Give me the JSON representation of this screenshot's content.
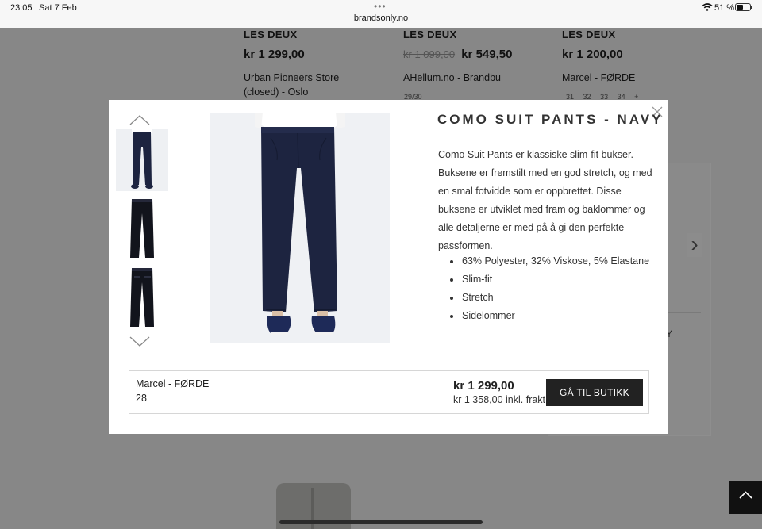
{
  "status_bar": {
    "time": "23:05",
    "date": "Sat 7 Feb",
    "url": "brandsonly.no",
    "battery_percent": "51 %"
  },
  "background_listing": [
    {
      "brand": "LES DEUX",
      "old_price": "",
      "price": "kr 1 299,00",
      "store": "Urban Pioneers Store (closed) - Oslo",
      "sizes": []
    },
    {
      "brand": "LES DEUX",
      "old_price": "kr 1 099,00",
      "price": "kr 549,50",
      "store": "AHellum.no - Brandbu",
      "sizes": [
        "29/30"
      ]
    },
    {
      "brand": "LES DEUX",
      "old_price": "",
      "price": "kr 1 200,00",
      "store": "Marcel - FØRDE",
      "sizes": [
        "31",
        "32",
        "33",
        "34",
        "+"
      ]
    }
  ],
  "background_card_text": "Y",
  "modal": {
    "title": "COMO SUIT PANTS - NAVY",
    "description": "Como Suit Pants er klassiske slim-fit bukser. Buksene er fremstilt med en god stretch, og med en smal fotvidde som er oppbrettet. Disse buksene er utviklet med fram og baklommer og alle detaljerne er med på å gi den perfekte passformen.",
    "features": [
      "63% Polyester, 32% Viskose, 5% Elastane",
      "Slim-fit",
      "Stretch",
      "Sidelommer"
    ],
    "offer": {
      "store": "Marcel - FØRDE",
      "size": "28",
      "price": "kr 1 299,00",
      "shipping": "kr 1 358,00 inkl. frakt",
      "button": "GÅ TIL BUTIKK"
    }
  },
  "icons": {
    "close": "close-icon",
    "thumb_prev": "chevron-up-icon",
    "thumb_next": "chevron-down-icon",
    "scroll_top": "chevron-up-icon"
  },
  "colors": {
    "overlay": "#878787",
    "button": "#222222",
    "navy": "#1d2440"
  }
}
